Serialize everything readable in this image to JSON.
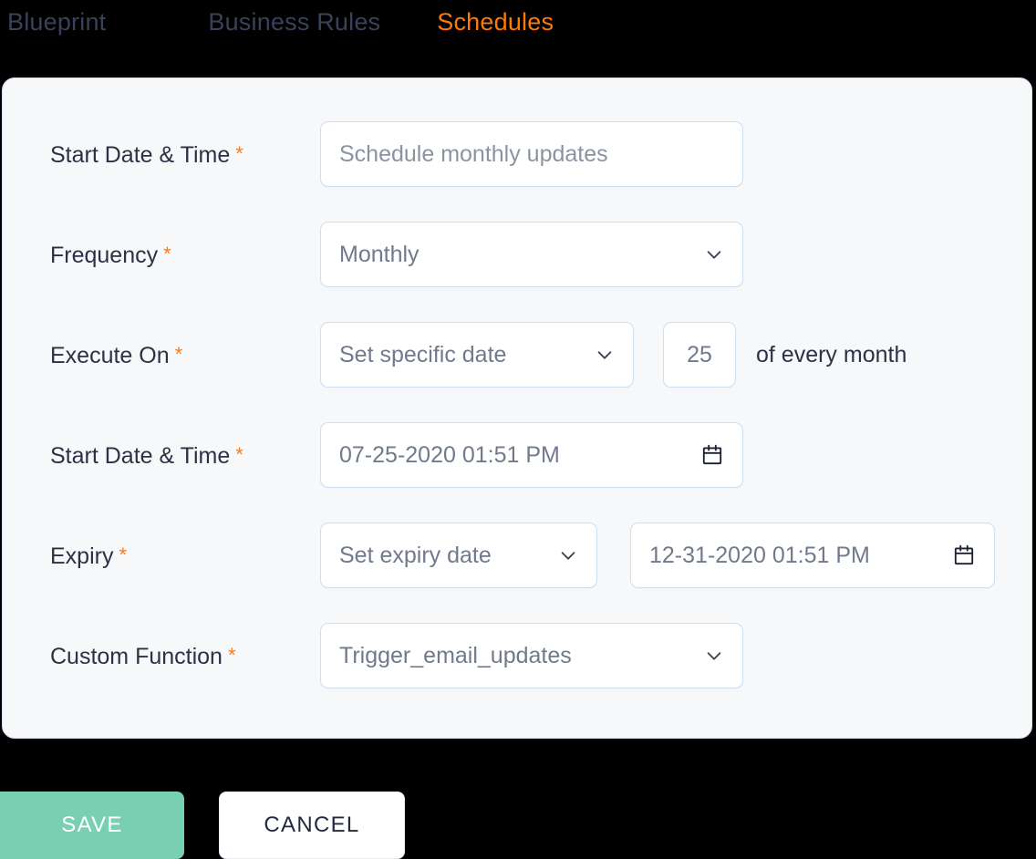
{
  "tabs": [
    {
      "label": "Blueprint",
      "active": false
    },
    {
      "label": "Business Rules",
      "active": false
    },
    {
      "label": "Schedules",
      "active": true
    }
  ],
  "colors": {
    "accent_orange": "#ff7a00",
    "required_orange": "#ff7a15",
    "tab_inactive": "#39425a",
    "save_green": "#78cfb1",
    "card_bg": "#f6f8fa",
    "field_border": "#cfdef0",
    "label_text": "#2b3245",
    "value_text": "#707a8c",
    "page_bg": "#000000"
  },
  "form": {
    "rows": [
      {
        "label": "Start Date & Time",
        "required_marker": "*",
        "input": {
          "name": "schedule-name-input",
          "placeholder": "Schedule monthly updates",
          "value": "",
          "display": "Schedule monthly updates",
          "is_placeholder": true
        }
      },
      {
        "label": "Frequency",
        "required_marker": "*",
        "select": {
          "name": "frequency-select",
          "display": "Monthly",
          "icon": "chevron-down-icon",
          "options": [
            "Monthly"
          ]
        }
      },
      {
        "label": "Execute On",
        "required_marker": "*",
        "select": {
          "name": "execute-on-select",
          "display": "Set specific date",
          "icon": "chevron-down-icon",
          "options": [
            "Set specific date"
          ]
        },
        "day_input": {
          "name": "day-of-month-input",
          "value": "25"
        },
        "suffix": "of every month"
      },
      {
        "label": "Start Date & Time",
        "required_marker": "*",
        "date": {
          "name": "start-datetime-input",
          "display": "07-25-2020 01:51 PM",
          "icon": "calendar-icon"
        }
      },
      {
        "label": "Expiry",
        "required_marker": "*",
        "select": {
          "name": "expiry-mode-select",
          "display": "Set expiry date",
          "icon": "chevron-down-icon",
          "options": [
            "Set expiry date"
          ]
        },
        "date": {
          "name": "expiry-datetime-input",
          "display": "12-31-2020 01:51 PM",
          "icon": "calendar-icon"
        }
      },
      {
        "label": "Custom Function",
        "required_marker": "*",
        "select": {
          "name": "custom-function-select",
          "display": "Trigger_email_updates",
          "icon": "chevron-down-icon",
          "options": [
            "Trigger_email_updates"
          ]
        }
      }
    ]
  },
  "footer": {
    "save_label": "SAVE",
    "cancel_label": "CANCEL"
  }
}
